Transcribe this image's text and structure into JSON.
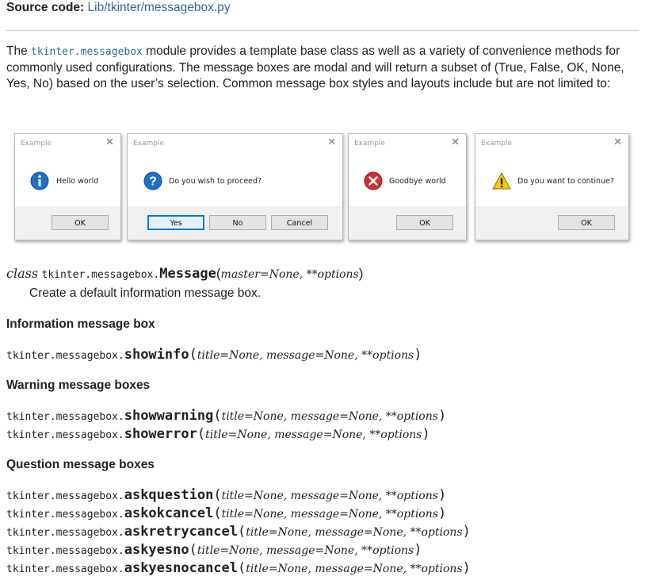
{
  "source": {
    "label": "Source code:",
    "link": "Lib/tkinter/messagebox.py"
  },
  "intro": {
    "before": "The ",
    "code": "tkinter.messagebox",
    "after": " module provides a template base class as well as a variety of convenience methods for commonly used configurations. The message boxes are modal and will return a subset of (True, False, OK, None, Yes, No) based on the user’s selection. Common message box styles and layouts include but are not limited to:"
  },
  "dialogs": [
    {
      "title": "Example",
      "message": "Hello world",
      "icon": "info-icon",
      "buttons": [
        "OK"
      ]
    },
    {
      "title": "Example",
      "message": "Do you wish to proceed?",
      "icon": "question-icon",
      "buttons": [
        "Yes",
        "No",
        "Cancel"
      ]
    },
    {
      "title": "Example",
      "message": "Goodbye world",
      "icon": "error-icon",
      "buttons": [
        "OK"
      ]
    },
    {
      "title": "Example",
      "message": "Do you want to continue?",
      "icon": "warning-icon",
      "buttons": [
        "OK"
      ]
    }
  ],
  "class_sig": {
    "keyword": "class",
    "prefix": "tkinter.messagebox.",
    "name": "Message",
    "params": "master=None, **options",
    "description": "Create a default information message box."
  },
  "sections": [
    {
      "heading": "Information message box",
      "functions": [
        {
          "name": "showinfo",
          "params": "title=None, message=None, **options"
        }
      ]
    },
    {
      "heading": "Warning message boxes",
      "functions": [
        {
          "name": "showwarning",
          "params": "title=None, message=None, **options"
        },
        {
          "name": "showerror",
          "params": "title=None, message=None, **options"
        }
      ]
    },
    {
      "heading": "Question message boxes",
      "functions": [
        {
          "name": "askquestion",
          "params": "title=None, message=None, **options"
        },
        {
          "name": "askokcancel",
          "params": "title=None, message=None, **options"
        },
        {
          "name": "askretrycancel",
          "params": "title=None, message=None, **options"
        },
        {
          "name": "askyesno",
          "params": "title=None, message=None, **options"
        },
        {
          "name": "askyesnocancel",
          "params": "title=None, message=None, **options"
        }
      ]
    }
  ],
  "prefix": "tkinter.messagebox.",
  "colors": {
    "link": "#3465a4",
    "code": "#2c6e8f",
    "info": "#1e70c8",
    "error": "#d0312d",
    "warning": "#f5c518"
  }
}
